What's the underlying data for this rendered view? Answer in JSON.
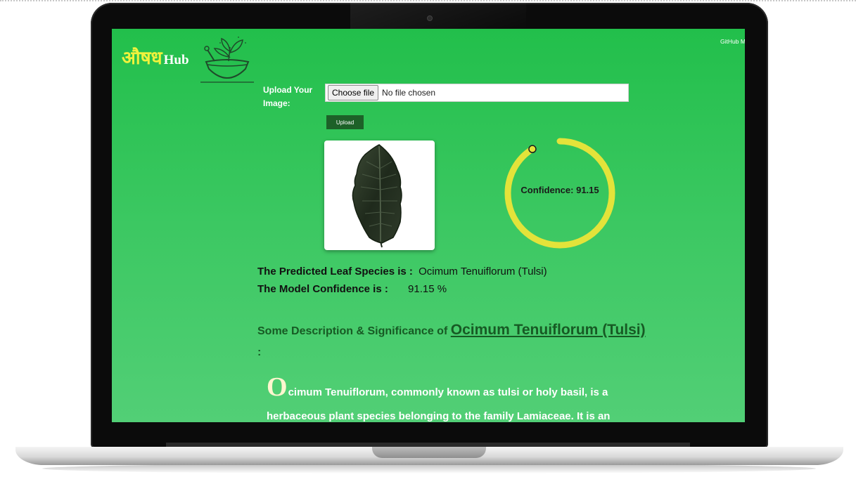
{
  "app": {
    "logo_hindi": "औषध",
    "logo_hub": "Hub",
    "nav_github": "GitHub M"
  },
  "upload": {
    "label": "Upload Your Image:",
    "choose_button": "Choose file",
    "file_status": "No file chosen",
    "upload_button": "Upload"
  },
  "gauge": {
    "text": "Confidence: 91.15",
    "value_percent": 91.15,
    "color": "#e3e33a"
  },
  "result": {
    "species_label": "The Predicted Leaf Species is :",
    "species_value": "Ocimum Tenuiflorum (Tulsi)",
    "confidence_label": "The Model Confidence is :",
    "confidence_value": "91.15 %"
  },
  "description": {
    "heading_prefix": "Some Description & Significance of",
    "heading_name": "Ocimum Tenuiflorum (Tulsi)",
    "heading_suffix": ":",
    "drop_cap": "O",
    "body": "cimum Tenuiflorum, commonly known as tulsi or holy basil, is a herbaceous plant species belonging to the family Lamiaceae. It is an"
  },
  "colors": {
    "screen_green": "#22bf4b",
    "logo_yellow": "#f0f23c",
    "upload_button": "#1d6128",
    "heading_dark_green": "#175a24"
  }
}
